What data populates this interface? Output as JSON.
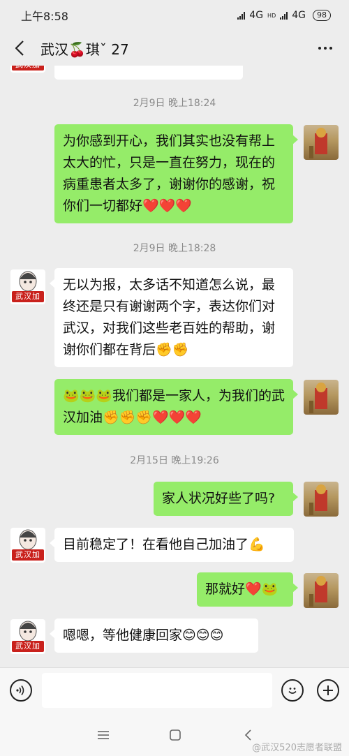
{
  "status_bar": {
    "time": "上午8:58",
    "network1": "4G",
    "network2": "4G",
    "hd": "HD",
    "battery": "98"
  },
  "header": {
    "title": "武汉🍒琪ˇ 27"
  },
  "messages": {
    "partial_top": "……",
    "ts1": "2月9日 晚上18:24",
    "m1": "为你感到开心，我们其实也没有帮上太大的忙，只是一直在努力，现在的病重患者太多了，谢谢你的感谢，祝你们一切都好❤️❤️❤️",
    "ts2": "2月9日 晚上18:28",
    "m2": "无以为报，太多话不知道怎么说，最终还是只有谢谢两个字，表达你们对武汉，对我们这些老百姓的帮助，谢谢你们都在背后✊✊",
    "m3": "🐸🐸🐸我们都是一家人，为我们的武汉加油✊✊✊❤️❤️❤️",
    "ts3": "2月15日 晚上19:26",
    "m4": "家人状况好些了吗?",
    "m5": "目前稳定了！在看他自己加油了💪",
    "m6": "那就好❤️🐸",
    "m7": "嗯嗯，等他健康回家😊😊😊"
  },
  "avatar_badge": "武汉加油",
  "input": {
    "placeholder": ""
  },
  "watermark": "@武汉520志愿者联盟",
  "colors": {
    "bg": "#ededed",
    "bubble_right": "#95ec69",
    "bubble_left": "#ffffff",
    "badge": "#c9211c"
  }
}
